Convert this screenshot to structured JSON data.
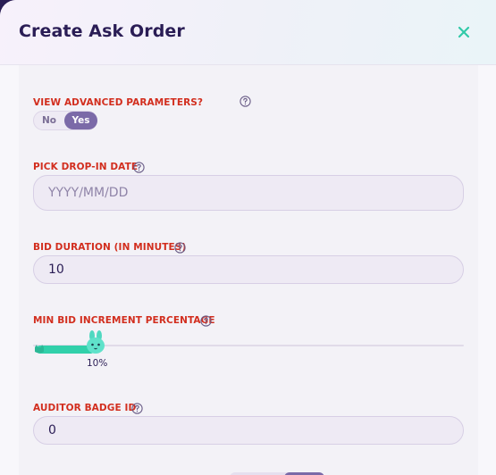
{
  "modal": {
    "title": "Create Ask Order"
  },
  "advanced": {
    "label": "VIEW ADVANCED PARAMETERS?",
    "options": [
      "No",
      "Yes"
    ],
    "selected": "Yes"
  },
  "drop_in_date": {
    "label": "PICK DROP-IN DATE",
    "value": "",
    "placeholder": "YYYY/MM/DD"
  },
  "bid_duration": {
    "label": "BID DURATION (IN MINUTES)",
    "value": "10"
  },
  "min_bid_increment": {
    "label": "MIN BID INCREMENT PERCENTAGE",
    "value_percent": 10,
    "display": "10%"
  },
  "auditor_badge": {
    "label": "AUDITOR BADGE ID",
    "value": "0"
  },
  "colors": {
    "brand": "#2a1d55",
    "label_red": "#d22e1e",
    "toggle_active": "#7b6aa8",
    "slider_fill": "#31d0aa",
    "close_icon": "#31c9a8"
  }
}
